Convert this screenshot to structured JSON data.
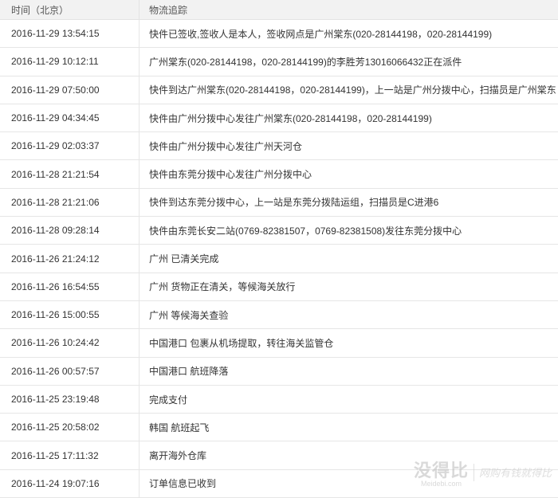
{
  "table": {
    "headers": {
      "time": "时间（北京）",
      "tracking": "物流追踪"
    },
    "rows": [
      {
        "time": "2016-11-29 13:54:15",
        "status": "快件已签收,签收人是本人，签收网点是广州棠东(020-28144198，020-28144199)"
      },
      {
        "time": "2016-11-29 10:12:11",
        "status": "广州棠东(020-28144198，020-28144199)的李胜芳13016066432正在派件"
      },
      {
        "time": "2016-11-29 07:50:00",
        "status": "快件到达广州棠东(020-28144198，020-28144199)，上一站是广州分拨中心，扫描员是广州棠东"
      },
      {
        "time": "2016-11-29 04:34:45",
        "status": "快件由广州分拨中心发往广州棠东(020-28144198，020-28144199)"
      },
      {
        "time": "2016-11-29 02:03:37",
        "status": "快件由广州分拨中心发往广州天河仓"
      },
      {
        "time": "2016-11-28 21:21:54",
        "status": "快件由东莞分拨中心发往广州分拨中心"
      },
      {
        "time": "2016-11-28 21:21:06",
        "status": "快件到达东莞分拨中心，上一站是东莞分拨陆运组，扫描员是C进港6"
      },
      {
        "time": "2016-11-28 09:28:14",
        "status": "快件由东莞长安二站(0769-82381507，0769-82381508)发往东莞分拨中心"
      },
      {
        "time": "2016-11-26 21:24:12",
        "status": "广州 已清关完成"
      },
      {
        "time": "2016-11-26 16:54:55",
        "status": "广州 货物正在清关，等候海关放行"
      },
      {
        "time": "2016-11-26 15:00:55",
        "status": "广州 等候海关查验"
      },
      {
        "time": "2016-11-26 10:24:42",
        "status": "中国港口 包裹从机场提取，转往海关监管仓"
      },
      {
        "time": "2016-11-26 00:57:57",
        "status": "中国港口 航班降落"
      },
      {
        "time": "2016-11-25 23:19:48",
        "status": "完成支付"
      },
      {
        "time": "2016-11-25 20:58:02",
        "status": "韩国 航班起飞"
      },
      {
        "time": "2016-11-25 17:11:32",
        "status": "离开海外仓库"
      },
      {
        "time": "2016-11-24 19:07:16",
        "status": "订单信息已收到"
      }
    ]
  },
  "watermark": {
    "logo": "没得比",
    "site": "Meidebi.com",
    "slogan": "网购有钱就得比"
  }
}
